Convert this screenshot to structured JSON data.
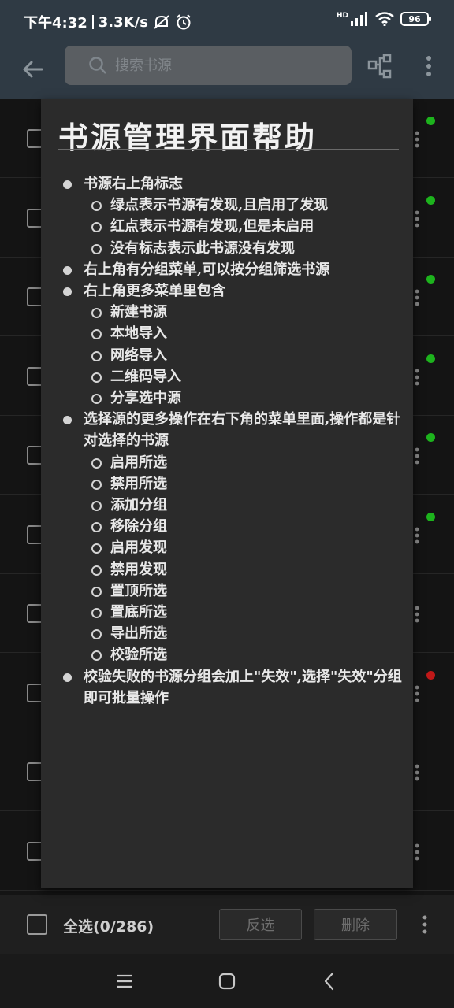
{
  "status_bar": {
    "time": "下午4:32",
    "net_speed": "3.3K/s",
    "signal": "HD",
    "battery": "96"
  },
  "toolbar": {
    "search_placeholder": "搜索书源"
  },
  "list_rows": [
    {
      "dot": "#1db31d"
    },
    {
      "dot": "#1db31d"
    },
    {
      "dot": "#1db31d"
    },
    {
      "dot": "#1db31d"
    },
    {
      "dot": "#1db31d"
    },
    {
      "dot": "#1db31d"
    },
    {
      "dot": ""
    },
    {
      "dot": "#c01818"
    },
    {
      "dot": ""
    },
    {
      "dot": ""
    }
  ],
  "bottom_bar": {
    "select_all": "全选(0/286)",
    "invert": "反选",
    "delete": "删除"
  },
  "dialog": {
    "title": "书源管理界面帮助",
    "items": [
      {
        "text": "书源右上角标志",
        "children": [
          "绿点表示书源有发现,且启用了发现",
          "红点表示书源有发现,但是未启用",
          "没有标志表示此书源没有发现"
        ]
      },
      {
        "text": "右上角有分组菜单,可以按分组筛选书源",
        "children": []
      },
      {
        "text": "右上角更多菜单里包含",
        "children": [
          "新建书源",
          "本地导入",
          "网络导入",
          "二维码导入",
          "分享选中源"
        ]
      },
      {
        "text": "选择源的更多操作在右下角的菜单里面,操作都是针对选择的书源",
        "children": [
          "启用所选",
          "禁用所选",
          "添加分组",
          "移除分组",
          "启用发现",
          "禁用发现",
          "置顶所选",
          "置底所选",
          "导出所选",
          "校验所选"
        ]
      },
      {
        "text": "校验失败的书源分组会加上\"失效\",选择\"失效\"分组即可批量操作",
        "children": []
      }
    ]
  },
  "colors": {
    "toolbar_bg": "#2f3a44",
    "dialog_bg": "#2b2b2b",
    "green_dot": "#1db31d",
    "red_dot": "#c01818"
  }
}
